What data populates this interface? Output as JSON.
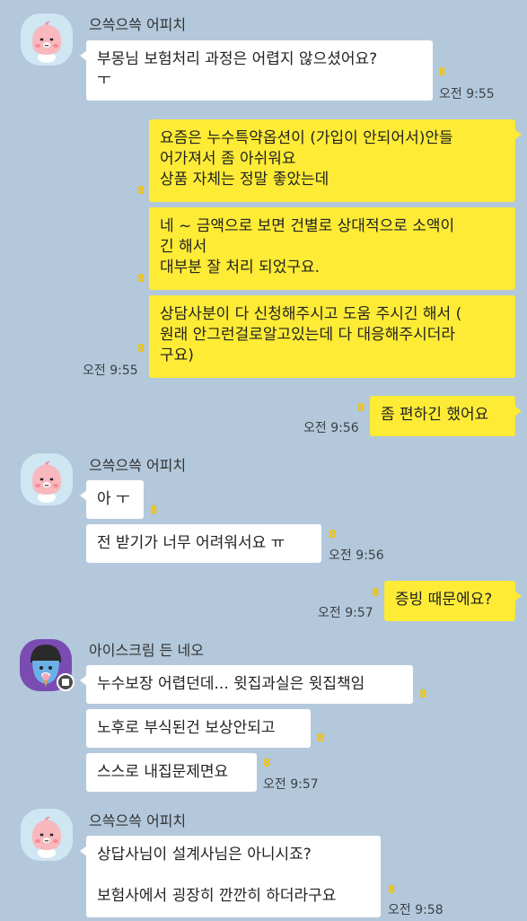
{
  "colors": {
    "background": "#b3c8db",
    "incoming_bubble": "#ffffff",
    "outgoing_bubble": "#fdeb36",
    "unread_count": "#f2c400"
  },
  "senders": {
    "apeach": "으쓱으쓱 어피치",
    "neo": "아이스크림 든 네오"
  },
  "messages": {
    "m1": {
      "text": "부몽님 보험처리 과정은 어렵지 않으셨어요?\nㅜ",
      "unread": "8",
      "time": "오전 9:55"
    },
    "m2": {
      "text": "요즘은 누수특약옵션이 (가입이 안되어서)안들\n어가져서 좀 아쉬워요\n상품 자체는 정말 좋았는데",
      "unread": "8"
    },
    "m3": {
      "text": "네 ~ 금액으로 보면 건별로 상대적으로 소액이\n긴 해서\n대부분 잘 처리 되었구요.",
      "unread": "8"
    },
    "m4": {
      "text": "상담사분이 다 신청해주시고 도움 주시긴 해서 (\n원래 안그런걸로알고있는데 다 대응해주시더라\n구요)",
      "unread": "8",
      "time": "오전 9:55"
    },
    "m5": {
      "text": "좀 편하긴 했어요",
      "unread": "8",
      "time": "오전 9:56"
    },
    "m6": {
      "text": "아 ㅜ",
      "unread": "8"
    },
    "m7": {
      "text": "전 받기가 너무 어려워서요 ㅠ",
      "unread": "8",
      "time": "오전 9:56"
    },
    "m8": {
      "text": "증빙 때문에요?",
      "unread": "8",
      "time": "오전 9:57"
    },
    "m9": {
      "text": "누수보장 어렵던데... 윗집과실은 윗집책임",
      "unread": "8"
    },
    "m10": {
      "text": "노후로 부식된건 보상안되고",
      "unread": "8"
    },
    "m11": {
      "text": "스스로 내집문제면요",
      "unread": "8",
      "time": "오전 9:57"
    },
    "m12": {
      "text": "상답사님이 설계사님은 아니시죠?\n\n보험사에서 굉장히 깐깐히 하더라구요",
      "unread": "8",
      "time": "오전 9:58"
    }
  }
}
